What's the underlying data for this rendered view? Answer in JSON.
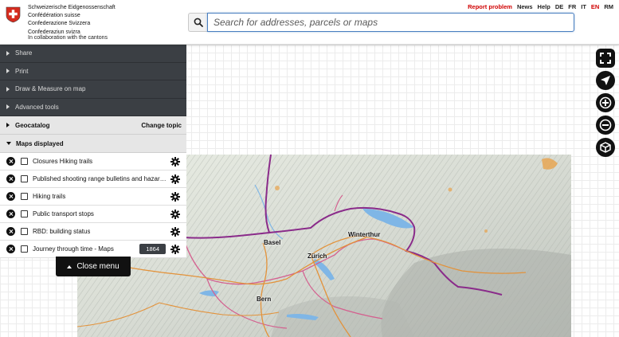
{
  "header": {
    "confederation_lines": [
      "Schweizerische Eidgenossenschaft",
      "Confédération suisse",
      "Confederazione Svizzera",
      "Confederaziun svizra"
    ],
    "collaboration": "In collaboration with the cantons",
    "report_problem": "Report problem",
    "news": "News",
    "help": "Help",
    "languages": [
      "DE",
      "FR",
      "IT",
      "EN",
      "RM"
    ],
    "active_language": "EN"
  },
  "search": {
    "placeholder": "Search for addresses, parcels or maps",
    "value": ""
  },
  "menu": {
    "items": [
      {
        "label": "Share"
      },
      {
        "label": "Print"
      },
      {
        "label": "Draw & Measure on map"
      },
      {
        "label": "Advanced tools"
      }
    ],
    "geocatalog": "Geocatalog",
    "change_topic": "Change topic",
    "maps_displayed": "Maps displayed",
    "layers": [
      {
        "label": "Closures Hiking trails",
        "checked": false
      },
      {
        "label": "Published shooting range bulletins and hazar…",
        "checked": false
      },
      {
        "label": "Hiking trails",
        "checked": false
      },
      {
        "label": "Public transport stops",
        "checked": false
      },
      {
        "label": "RBD: building status",
        "checked": false
      },
      {
        "label": "Journey through time - Maps",
        "checked": false,
        "year": "1864"
      }
    ],
    "close_menu": "Close menu"
  },
  "map": {
    "cities": [
      "Basel",
      "Winterthur",
      "Zürich",
      "Bern"
    ]
  },
  "tools": [
    "fullscreen-icon",
    "geolocation-icon",
    "zoom-in-icon",
    "zoom-out-icon",
    "3d-view-icon"
  ],
  "colors": {
    "brand_red": "#d00000",
    "menu_dark": "#3b3f44",
    "search_border": "#4a7fc0"
  }
}
